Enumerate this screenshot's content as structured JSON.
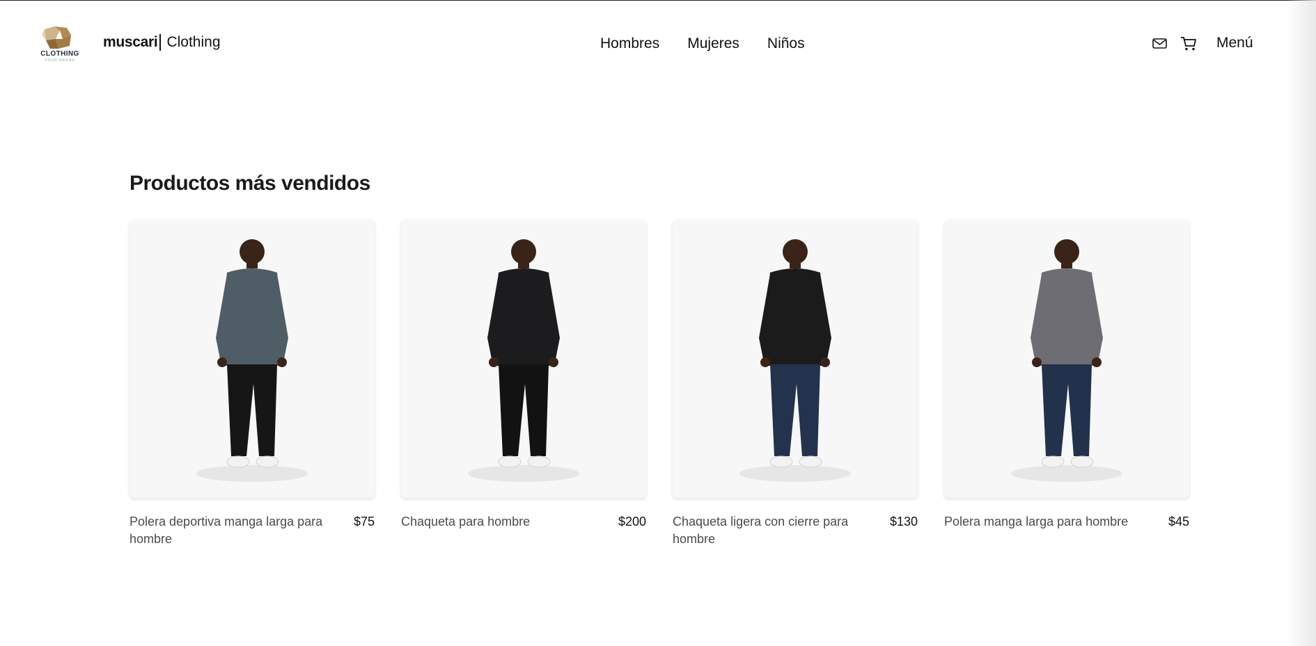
{
  "brand": {
    "name_bold": "muscari",
    "name_light": "Clothing",
    "logo_caption": "CLOTHING",
    "logo_tagline": "YOUR BRAND"
  },
  "nav": {
    "items": [
      {
        "label": "Hombres"
      },
      {
        "label": "Mujeres"
      },
      {
        "label": "Niños"
      }
    ]
  },
  "actions": {
    "mail_icon": "mail-icon",
    "cart_icon": "cart-icon",
    "menu_label": "Menú"
  },
  "section": {
    "title": "Productos más vendidos"
  },
  "products": [
    {
      "name": "Polera deportiva manga larga para hombre",
      "price": "$75",
      "top_color": "#4f5d66",
      "pants_color": "#161616"
    },
    {
      "name": "Chaqueta para hombre",
      "price": "$200",
      "top_color": "#1c1c1e",
      "pants_color": "#121212"
    },
    {
      "name": "Chaqueta ligera con cierre para hombre",
      "price": "$130",
      "top_color": "#1b1b1b",
      "pants_color": "#23324d"
    },
    {
      "name": "Polera manga larga para hombre",
      "price": "$45",
      "top_color": "#6d6d73",
      "pants_color": "#22314c"
    }
  ],
  "colors": {
    "gold": "#b08a52",
    "card_bg": "#f7f7f7",
    "text_muted": "#4a4a4a"
  }
}
